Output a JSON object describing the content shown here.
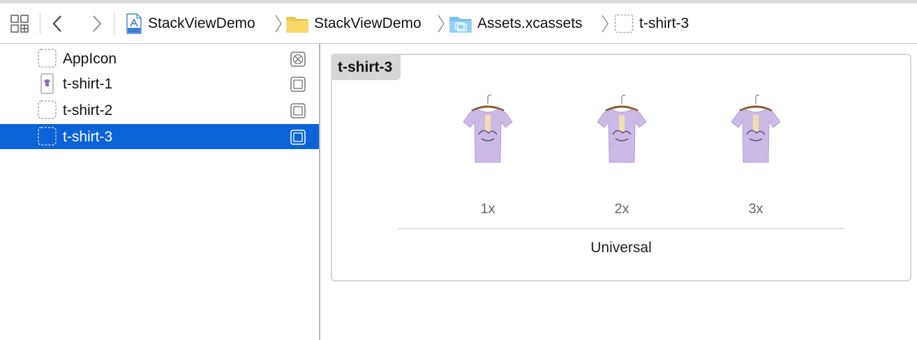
{
  "toolbar": {
    "breadcrumbs": [
      {
        "label": "StackViewDemo",
        "icon": "xcode-project-icon"
      },
      {
        "label": "StackViewDemo",
        "icon": "yellow-folder-icon"
      },
      {
        "label": "Assets.xcassets",
        "icon": "blue-assets-folder-icon"
      },
      {
        "label": "t-shirt-3",
        "icon": "image-set-icon"
      }
    ]
  },
  "sidebar": {
    "items": [
      {
        "label": "AppIcon",
        "selected": false
      },
      {
        "label": "t-shirt-1",
        "selected": false
      },
      {
        "label": "t-shirt-2",
        "selected": false
      },
      {
        "label": "t-shirt-3",
        "selected": true
      }
    ]
  },
  "detail": {
    "title": "t-shirt-3",
    "scales": [
      "1x",
      "2x",
      "3x"
    ],
    "idiom": "Universal"
  },
  "colors": {
    "selection": "#0b63d8",
    "shirt": "#cbb9e6"
  }
}
